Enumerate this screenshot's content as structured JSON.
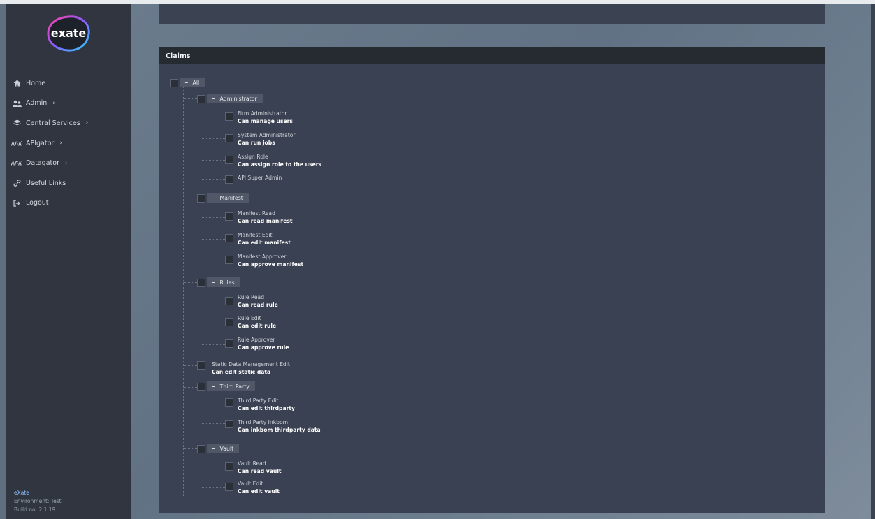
{
  "app": {
    "logo_text": "exate"
  },
  "sidebar": {
    "items": [
      {
        "label": "Home",
        "icon": "home-icon",
        "chevron": false
      },
      {
        "label": "Admin",
        "icon": "users-icon",
        "chevron": true
      },
      {
        "label": "Central Services",
        "icon": "layers-icon",
        "chevron": true
      },
      {
        "label": "APIgator",
        "icon": "apigator-icon",
        "chevron": true
      },
      {
        "label": "Datagator",
        "icon": "datagator-icon",
        "chevron": true
      },
      {
        "label": "Useful Links",
        "icon": "link-icon",
        "chevron": false
      },
      {
        "label": "Logout",
        "icon": "logout-icon",
        "chevron": false
      }
    ],
    "footer": {
      "brand": "eXate",
      "environment": "Environment: Test",
      "build": "Build no: 2.1.19"
    }
  },
  "claims": {
    "title": "Claims",
    "root_label": "All",
    "groups": [
      {
        "label": "Administrator",
        "items": [
          {
            "title": "Firm Administrator",
            "desc": "Can manage users"
          },
          {
            "title": "System Administrator",
            "desc": "Can run jobs"
          },
          {
            "title": "Assign Role",
            "desc": "Can assign role to the users"
          },
          {
            "title": "API Super Admin",
            "desc": ""
          }
        ]
      },
      {
        "label": "Manifest",
        "items": [
          {
            "title": "Manifest Read",
            "desc": "Can read manifest"
          },
          {
            "title": "Manifest Edit",
            "desc": "Can edit manifest"
          },
          {
            "title": "Manifest Approver",
            "desc": "Can approve manifest"
          }
        ]
      },
      {
        "label": "Rules",
        "items": [
          {
            "title": "Rule Read",
            "desc": "Can read rule"
          },
          {
            "title": "Rule Edit",
            "desc": "Can edit rule"
          },
          {
            "title": "Rule Approver",
            "desc": "Can approve rule"
          }
        ]
      },
      {
        "label": "",
        "single": {
          "title": "Static Data Management Edit",
          "desc": "Can edit static data"
        }
      },
      {
        "label": "Third Party",
        "items": [
          {
            "title": "Third Party Edit",
            "desc": "Can edit thirdparty"
          },
          {
            "title": "Third Party Inkbom",
            "desc": "Can inkbom thirdparty data"
          }
        ]
      },
      {
        "label": "Vault",
        "items": [
          {
            "title": "Vault Read",
            "desc": "Can read vault"
          },
          {
            "title": "Vault Edit",
            "desc": "Can edit vault"
          }
        ]
      }
    ]
  },
  "colors": {
    "accent": "#8fc1ff",
    "sidebar_bg": "#30353f",
    "panel_bg": "#3a4152"
  }
}
